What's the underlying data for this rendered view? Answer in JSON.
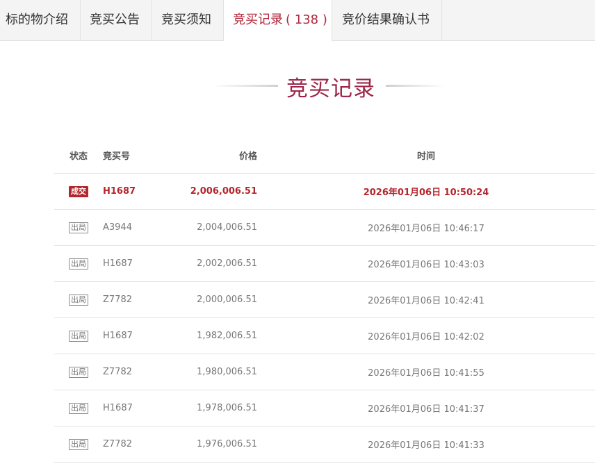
{
  "tabs": [
    {
      "label": "标的物介绍",
      "count": ""
    },
    {
      "label": "竞买公告",
      "count": ""
    },
    {
      "label": "竞买须知",
      "count": ""
    },
    {
      "label": "竞买记录",
      "count": "( 138 )"
    },
    {
      "label": "竞价结果确认书",
      "count": ""
    }
  ],
  "active_tab": 3,
  "heading": "竞买记录",
  "table": {
    "headers": {
      "status": "状态",
      "bidder": "竞买号",
      "price": "价格",
      "time": "时间"
    },
    "rows": [
      {
        "status": "成交",
        "bidder": "H1687",
        "price": "2,006,006.51",
        "time": "2026年01月06日 10:50:24"
      },
      {
        "status": "出局",
        "bidder": "A3944",
        "price": "2,004,006.51",
        "time": "2026年01月06日 10:46:17"
      },
      {
        "status": "出局",
        "bidder": "H1687",
        "price": "2,002,006.51",
        "time": "2026年01月06日 10:43:03"
      },
      {
        "status": "出局",
        "bidder": "Z7782",
        "price": "2,000,006.51",
        "time": "2026年01月06日 10:42:41"
      },
      {
        "status": "出局",
        "bidder": "H1687",
        "price": "1,982,006.51",
        "time": "2026年01月06日 10:42:02"
      },
      {
        "status": "出局",
        "bidder": "Z7782",
        "price": "1,980,006.51",
        "time": "2026年01月06日 10:41:55"
      },
      {
        "status": "出局",
        "bidder": "H1687",
        "price": "1,978,006.51",
        "time": "2026年01月06日 10:41:37"
      },
      {
        "status": "出局",
        "bidder": "Z7782",
        "price": "1,976,006.51",
        "time": "2026年01月06日 10:41:33"
      }
    ]
  },
  "colors": {
    "accent": "#b3262d",
    "heading": "#9c2548",
    "tab_bg": "#f4f4f4"
  }
}
